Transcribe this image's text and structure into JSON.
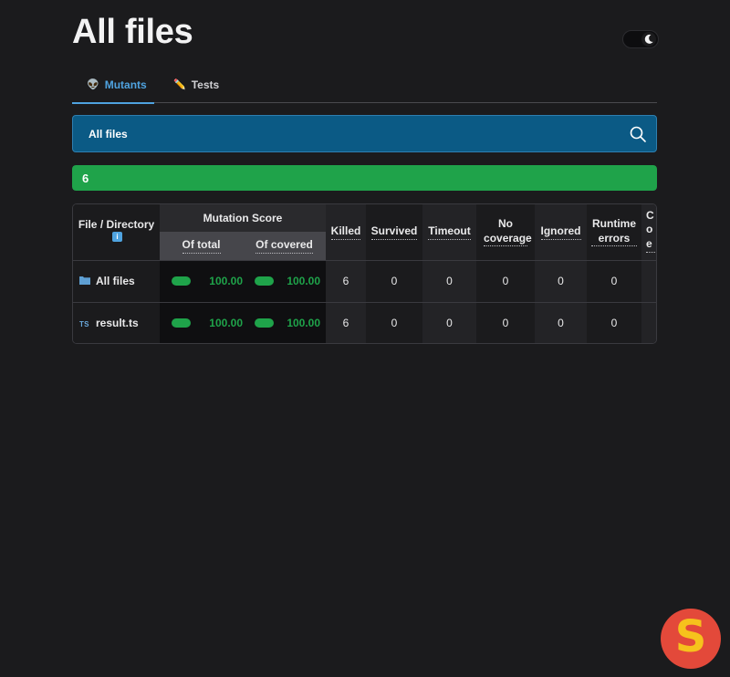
{
  "header": {
    "title": "All files"
  },
  "tabs": [
    {
      "label": "Mutants",
      "icon": "alien-icon",
      "active": true
    },
    {
      "label": "Tests",
      "icon": "pencil-icon",
      "active": false
    }
  ],
  "breadcrumb": {
    "label": "All files",
    "icon": "search-icon"
  },
  "progress": {
    "value_label": "6",
    "fraction": 1.0,
    "color": "#1fa34a"
  },
  "table": {
    "headers": {
      "file": "File / Directory",
      "mutation_score": "Mutation Score",
      "of_total": "Of total",
      "of_covered": "Of covered",
      "killed": "Killed",
      "survived": "Survived",
      "timeout": "Timeout",
      "no_coverage": "No coverage",
      "ignored": "Ignored",
      "runtime_errors": "Runtime errors",
      "compile_errors": "Co e"
    },
    "rows": [
      {
        "icon": "folder-icon",
        "name": "All files",
        "of_total": "100.00",
        "of_covered": "100.00",
        "killed": "6",
        "survived": "0",
        "timeout": "0",
        "no_coverage": "0",
        "ignored": "0",
        "runtime_errors": "0"
      },
      {
        "icon": "typescript-file-icon",
        "icon_text": "TS",
        "name": "result.ts",
        "of_total": "100.00",
        "of_covered": "100.00",
        "killed": "6",
        "survived": "0",
        "timeout": "0",
        "no_coverage": "0",
        "ignored": "0",
        "runtime_errors": "0"
      }
    ]
  },
  "badge": {
    "letter": "S",
    "colors": {
      "bg": "#e3493a",
      "fg": "#f6c21c"
    }
  },
  "colors": {
    "accent": "#4fa3e0",
    "success": "#1fa34a",
    "bar": "#0b5a85"
  }
}
